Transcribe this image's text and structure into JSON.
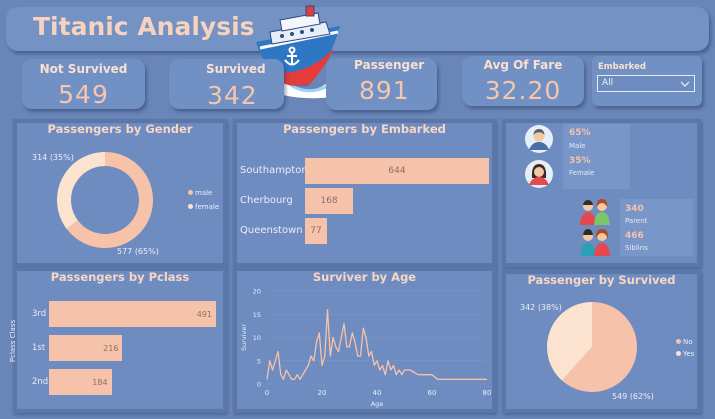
{
  "title": "Titanic Analysis",
  "colors": {
    "background": "#6a86b8",
    "accent": "#f6c2aa",
    "bar_text": "#8a6f6f"
  },
  "cards": {
    "not_survived": {
      "label": "Not Survived",
      "value": "549"
    },
    "survived": {
      "label": "Survived",
      "value": "342"
    },
    "passenger": {
      "label": "Passenger",
      "value": "891"
    },
    "avg_fare": {
      "label": "Avg Of Fare",
      "value": "32.20"
    }
  },
  "slicer": {
    "label": "Embarked",
    "selected": "All"
  },
  "stats": {
    "male_pct": "65%",
    "male_label": "Male",
    "female_pct": "35%",
    "female_label": "Female",
    "parent_value": "340",
    "parent_label": "Parent",
    "siblings_value": "466",
    "siblings_label": "Siblins"
  },
  "chart_data": [
    {
      "type": "pie",
      "title": "Passengers by Gender",
      "style": "donut",
      "categories": [
        "male",
        "female"
      ],
      "values": [
        577,
        314
      ],
      "data_labels": [
        "577 (65%)",
        "314 (35%)"
      ],
      "colors": [
        "#f6c2aa",
        "#fbe3d0"
      ],
      "legend": {
        "position": "right",
        "items": [
          "male",
          "female"
        ]
      }
    },
    {
      "type": "bar",
      "orientation": "horizontal",
      "title": "Passengers by Embarked",
      "categories": [
        "Southampton",
        "Cherbourg",
        "Queenstown"
      ],
      "values": [
        644,
        168,
        77
      ]
    },
    {
      "type": "bar",
      "orientation": "horizontal",
      "title": "Passengers by Pclass",
      "ylabel": "Pclass Class",
      "categories": [
        "3rd",
        "1st",
        "2nd"
      ],
      "values": [
        491,
        216,
        184
      ]
    },
    {
      "type": "line",
      "title": "Surviver by Age",
      "xlabel": "Age",
      "ylabel": "Surviver",
      "xlim": [
        0,
        80
      ],
      "ylim": [
        0,
        20
      ],
      "xticks": [
        0,
        20,
        40,
        60,
        80
      ],
      "yticks": [
        0,
        5,
        10,
        15,
        20
      ],
      "grid": true,
      "x": [
        0,
        1,
        2,
        3,
        4,
        5,
        6,
        7,
        8,
        9,
        10,
        11,
        12,
        13,
        14,
        15,
        16,
        17,
        18,
        19,
        20,
        21,
        22,
        23,
        24,
        25,
        26,
        27,
        28,
        29,
        30,
        31,
        32,
        33,
        34,
        35,
        36,
        37,
        38,
        39,
        40,
        41,
        42,
        43,
        44,
        45,
        46,
        47,
        48,
        49,
        50,
        52,
        55,
        58,
        60,
        62,
        65,
        70,
        80
      ],
      "y": [
        1,
        5,
        3,
        5,
        7,
        2,
        1,
        3,
        2,
        1,
        1,
        2,
        1,
        2,
        3,
        4,
        6,
        5,
        9,
        11,
        4,
        6,
        16,
        6,
        10,
        8,
        7,
        10,
        13,
        8,
        8,
        11,
        9,
        6,
        6,
        12,
        10,
        6,
        7,
        4,
        5,
        3,
        4,
        2,
        5,
        3,
        4,
        2,
        3,
        2,
        3,
        3,
        2,
        2,
        2,
        1,
        1,
        1,
        1
      ]
    },
    {
      "type": "pie",
      "title": "Passenger by Survived",
      "categories": [
        "No",
        "Yes"
      ],
      "values": [
        549,
        342
      ],
      "data_labels": [
        "549 (62%)",
        "342 (38%)"
      ],
      "colors": [
        "#f6c2aa",
        "#fbe3d0"
      ],
      "legend": {
        "position": "right",
        "items": [
          "No",
          "Yes"
        ]
      }
    }
  ]
}
